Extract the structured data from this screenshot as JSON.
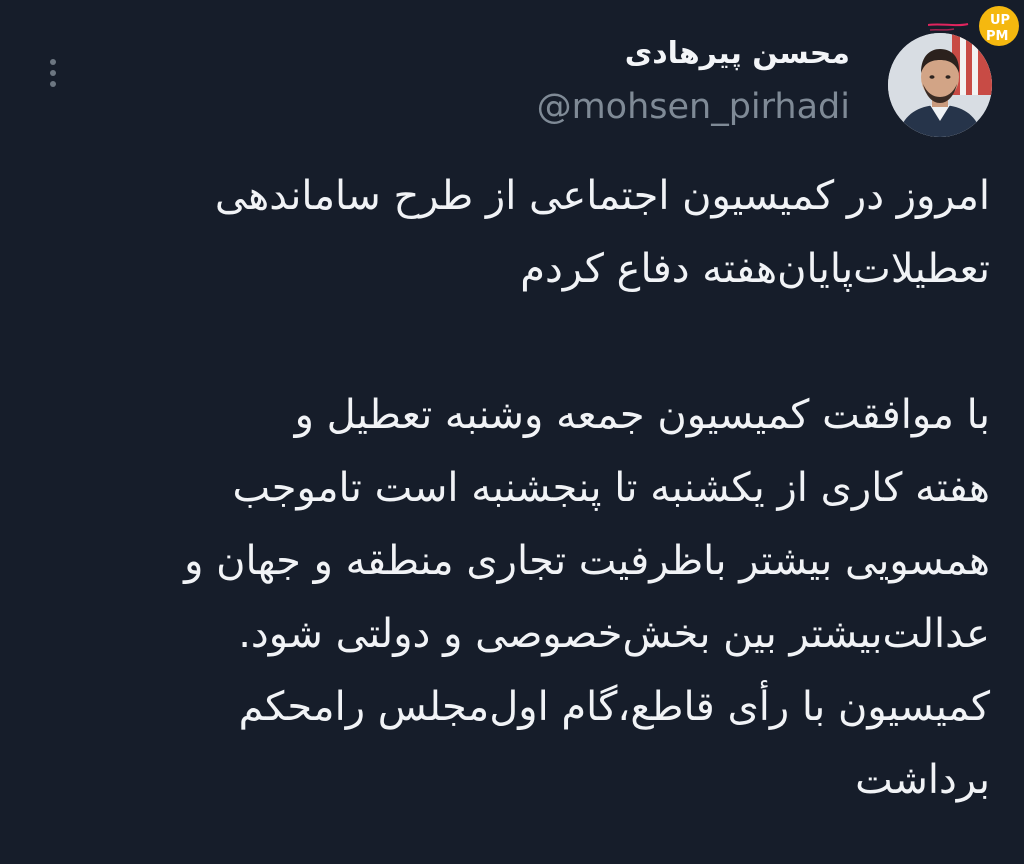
{
  "tweet": {
    "author_name": "محسن پیرهادی",
    "author_handle": "@mohsen_pirhadi",
    "lines": [
      "امروز در کمیسیون اجتماعی از طرح ساماندهی",
      "تعطیلات‌پایان‌هفته دفاع کردم",
      "",
      "با موافقت کمیسیون جمعه وشنبه تعطیل و",
      "هفته کاری از یکشنبه تا پنجشنبه است تاموجب",
      "همسویی بیشتر باظرفیت تجاری منطقه و جهان و",
      "عدالت‌بیشتر بین بخش‌خصوصی و دولتی شود.",
      "کمیسیون با رأی قاطع،گام اول‌مجلس رامحکم",
      "برداشت"
    ]
  },
  "watermark": {
    "logo_text": "UP PM"
  },
  "colors": {
    "background": "#161d2a",
    "text": "#f1f3f6",
    "handle": "#7f8a96",
    "dots": "#6c7681",
    "watermark_yellow": "#f5b80f",
    "watermark_pink": "#e0245e"
  }
}
